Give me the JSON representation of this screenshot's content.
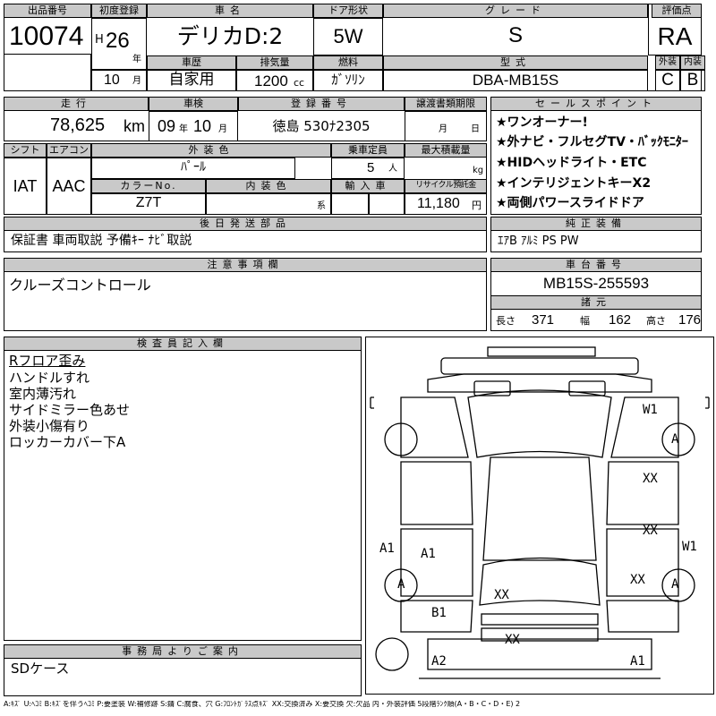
{
  "header": {
    "lot_label": "出品番号",
    "lot": "10074",
    "reg_label": "初度登録",
    "era": "H",
    "year": "26",
    "year_unit": "年",
    "month": "10",
    "month_unit": "月",
    "name_label": "車名",
    "name": "デリカD:2",
    "door_label": "ドア形状",
    "door": "5W",
    "grade_label": "グレード",
    "grade": "S",
    "rating_label": "評価点",
    "rating": "RA",
    "history_label": "車歴",
    "history": "自家用",
    "disp_label": "排気量",
    "disp": "1200",
    "disp_unit": "cc",
    "fuel_label": "燃料",
    "fuel": "ｶﾞｿﾘﾝ",
    "model_label": "型式",
    "model": "DBA-MB15S",
    "ext_label": "外装",
    "ext": "C",
    "int_label": "内装",
    "int": "B"
  },
  "row2": {
    "mileage_label": "走行",
    "mileage": "78,625",
    "mileage_unit": "km",
    "inspect_label": "車検",
    "inspect_year": "09",
    "inspect_year_unit": "年",
    "inspect_month": "10",
    "inspect_month_unit": "月",
    "plate_label": "登録番号",
    "plate": "徳島 530ﾅ2305",
    "transfer_label": "譲渡書類期限",
    "transfer_month_unit": "月",
    "transfer_day_unit": "日"
  },
  "row3": {
    "shift_label": "シフト",
    "shift": "IAT",
    "ac_label": "エアコン",
    "ac": "AAC",
    "color_label": "外装色",
    "color": "ﾊﾟｰﾙ",
    "capacity_label": "乗車定員",
    "capacity": "5",
    "capacity_unit": "人",
    "load_label": "最大積載量",
    "load_unit": "kg",
    "color_no_label": "カラーNo.",
    "color_no": "Z7T",
    "int_color_label": "内装色",
    "int_color_unit": "系",
    "import_label": "輸入車",
    "recycle_label": "リサイクル預託金",
    "recycle": "11,180",
    "recycle_unit": "円"
  },
  "selling": {
    "label": "セールスポイント",
    "points": [
      "★ワンオーナー!",
      "★外ナビ・フルセグTV・ﾊﾞｯｸﾓﾆﾀｰ",
      "★HIDヘッドライト・ETC",
      "★インテリジェントキーX2",
      "★両側パワースライドドア"
    ]
  },
  "later": {
    "label": "後日発送部品",
    "text": "保証書 車両取説 予備ｷｰ ﾅﾋﾞ取説"
  },
  "equip": {
    "label": "純正装備",
    "text": "ｴｱB ｱﾙﾐ PS PW"
  },
  "notes": {
    "label": "注意事項欄",
    "text": "クルーズコントロール"
  },
  "chassis": {
    "label": "車台番号",
    "number": "MB15S-255593"
  },
  "dims": {
    "label": "諸元",
    "length_label": "長さ",
    "length": "371",
    "width_label": "幅",
    "width": "162",
    "height_label": "高さ",
    "height": "176"
  },
  "inspector": {
    "label": "検査員記入欄",
    "lines": [
      "Rフロア歪み",
      "ハンドルすれ",
      "室内薄汚れ",
      "サイドミラー色あせ",
      "外装小傷有り",
      "ロッカーカバー下A"
    ]
  },
  "office": {
    "label": "事務局よりご案内",
    "text": "SDケース"
  },
  "diagram": {
    "marks": {
      "w1_top": "W1",
      "a_rf_tire": "A",
      "xx_rf_door": "XX",
      "xx_rr_door": "XX",
      "w1_right": "W1",
      "xx_rr": "XX",
      "a_rr_tire": "A",
      "a1_left": "A1",
      "a1_inner": "A1",
      "a_lr_tire": "A",
      "xx_cargo": "XX",
      "b1": "B1",
      "xx_bumper": "XX",
      "a2": "A2",
      "a1_bottom": "A1"
    }
  },
  "legend": "A:ｷｽﾞ U:ﾍｺﾐ B:ｷｽﾞを伴うﾍｺﾐ P:要塗装 W:補修跡 S:錆 C:腐食、穴 G:ﾌﾛﾝﾄｶﾞﾗｽ点ｷｽﾞ XX:交換済み X:要交換 欠:欠品 内・外装評価 5段階ﾗﾝｸ順(A・B・C・D・E) 2"
}
